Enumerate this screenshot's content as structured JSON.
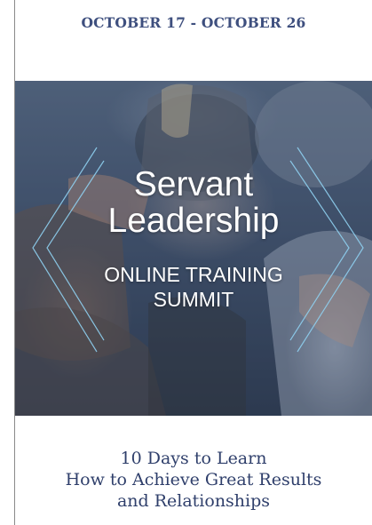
{
  "header": {
    "date_range": "OCTOBER 17 - OCTOBER 26"
  },
  "hero": {
    "title_line1": "Servant",
    "title_line2": "Leadership",
    "subtitle_line1": "ONLINE TRAINING",
    "subtitle_line2": "SUMMIT"
  },
  "tagline": {
    "line1": "10 Days to Learn",
    "line2": "How to Achieve Great Results",
    "line3": "and Relationships"
  },
  "colors": {
    "heading_navy": "#3e4f7e",
    "tagline_navy": "#2f3f6b",
    "chevron_blue": "#8fd0f0",
    "title_white": "#ffffff"
  },
  "icons": {
    "left_decoration": "left-chevron-outline-icon",
    "right_decoration": "right-chevron-outline-icon"
  }
}
